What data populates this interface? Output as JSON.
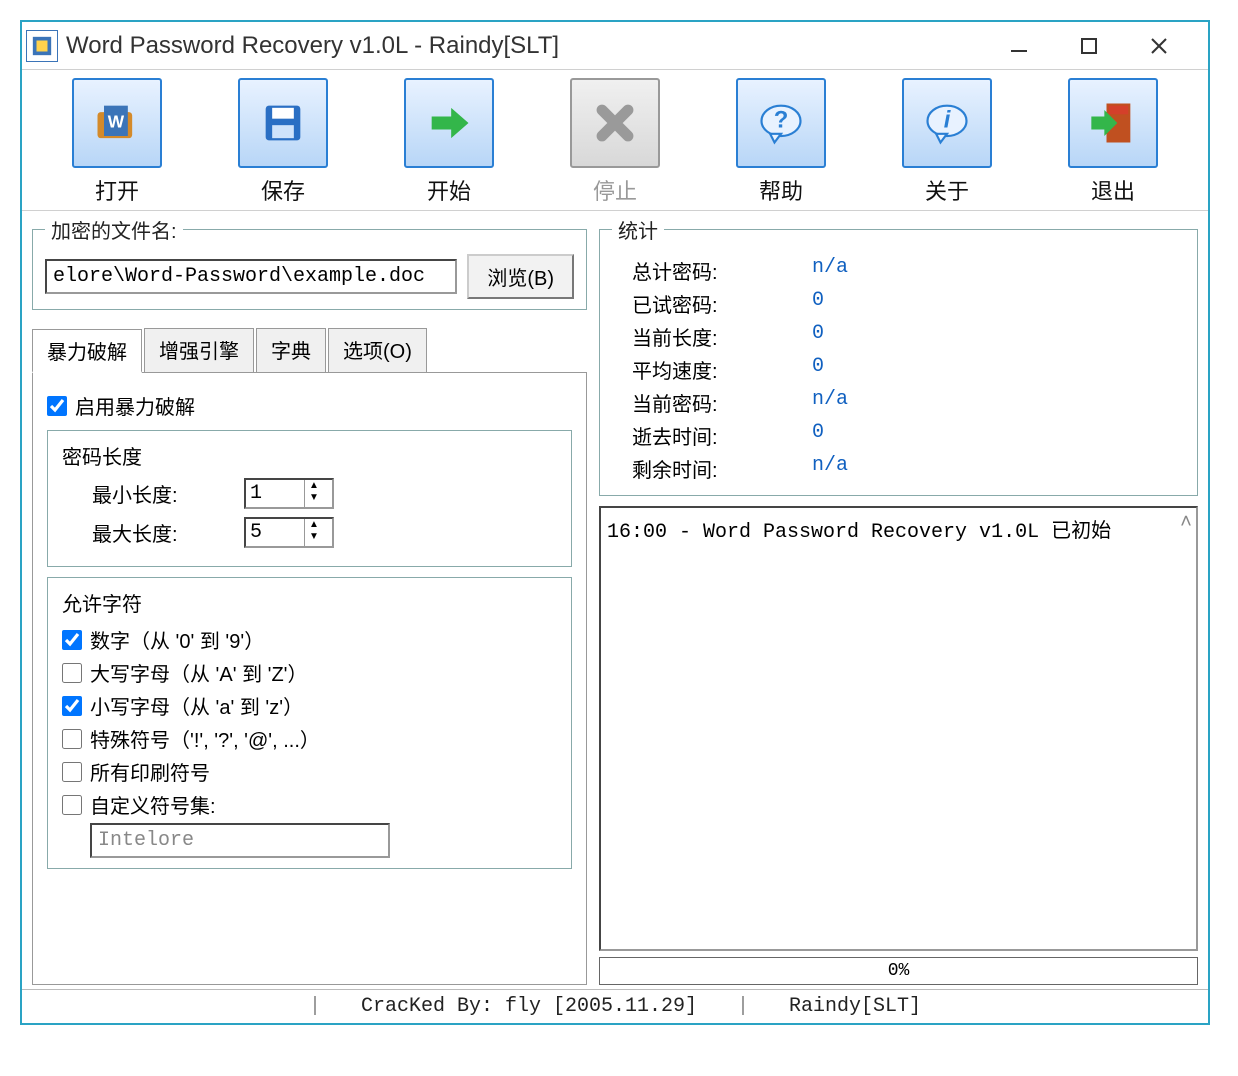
{
  "window": {
    "title": "Word Password Recovery v1.0L - Raindy[SLT]"
  },
  "toolbar": {
    "open": "打开",
    "save": "保存",
    "start": "开始",
    "stop": "停止",
    "help": "帮助",
    "about": "关于",
    "exit": "退出"
  },
  "file": {
    "group_label": "加密的文件名:",
    "path": "elore\\Word-Password\\example.doc",
    "browse": "浏览(B)"
  },
  "tabs": {
    "brute": "暴力破解",
    "engine": "增强引擎",
    "dict": "字典",
    "options": "选项(O)"
  },
  "brute": {
    "enable": "启用暴力破解",
    "len_group": "密码长度",
    "min_label": "最小长度:",
    "min_value": "1",
    "max_label": "最大长度:",
    "max_value": "5",
    "chars_group": "允许字符",
    "chk_digits": "数字（从 '0' 到 '9'）",
    "chk_upper": "大写字母（从 'A' 到 'Z'）",
    "chk_lower": "小写字母（从 'a' 到 'z'）",
    "chk_special": "特殊符号（'!', '?', '@', ...）",
    "chk_print": "所有印刷符号",
    "chk_custom": "自定义符号集:",
    "custom_value": "Intelore"
  },
  "stats": {
    "group_label": "统计",
    "total_label": "总计密码:",
    "total_val": "n/a",
    "tried_label": "已试密码:",
    "tried_val": "0",
    "curlen_label": "当前长度:",
    "curlen_val": "0",
    "speed_label": "平均速度:",
    "speed_val": "0",
    "curpwd_label": "当前密码:",
    "curpwd_val": "n/a",
    "elapsed_label": "逝去时间:",
    "elapsed_val": "0",
    "remain_label": "剩余时间:",
    "remain_val": "n/a"
  },
  "log": {
    "line1": "16:00 - Word Password Recovery v1.0L 已初始"
  },
  "progress": {
    "text": "0%"
  },
  "status": {
    "cracked": "CracKed By: fly [2005.11.29]",
    "author": "Raindy[SLT]"
  },
  "icons": {
    "app": "app-icon",
    "minimize": "minimize-icon",
    "maximize": "maximize-icon",
    "close": "close-icon"
  }
}
